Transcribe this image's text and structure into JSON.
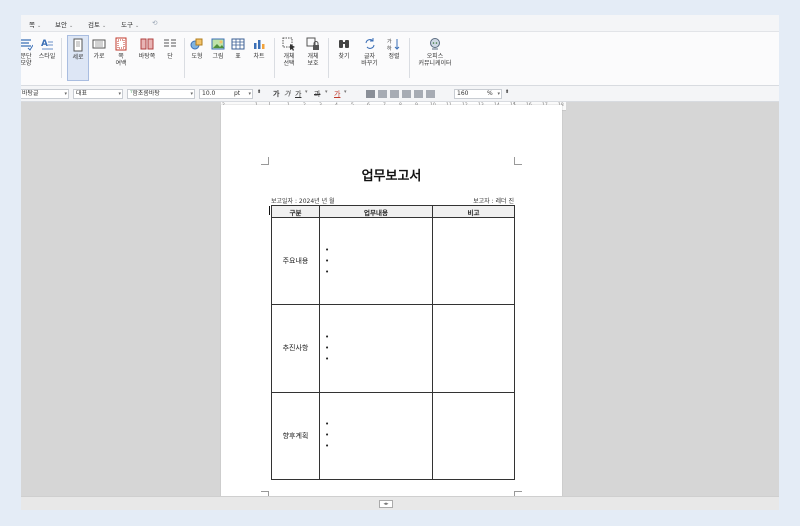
{
  "menubar": {
    "items": [
      {
        "label": "쪽"
      },
      {
        "label": "보안"
      },
      {
        "label": "검토"
      },
      {
        "label": "도구"
      }
    ],
    "chevron": "⌄"
  },
  "ribbon": {
    "buttons": [
      {
        "label": "문단\n모양",
        "icon": "paragraph-shape-icon"
      },
      {
        "label": "스타일",
        "icon": "style-icon"
      },
      {
        "label": "세로",
        "icon": "portrait-icon",
        "active": true
      },
      {
        "label": "가로",
        "icon": "landscape-icon"
      },
      {
        "label": "쪽\n여백",
        "icon": "page-margin-icon"
      },
      {
        "label": "바탕쪽",
        "icon": "master-page-icon"
      },
      {
        "label": "단",
        "icon": "columns-icon"
      },
      {
        "label": "도형",
        "icon": "shape-icon"
      },
      {
        "label": "그림",
        "icon": "picture-icon"
      },
      {
        "label": "표",
        "icon": "table-icon"
      },
      {
        "label": "차트",
        "icon": "chart-icon"
      },
      {
        "label": "개체\n선택",
        "icon": "select-object-icon"
      },
      {
        "label": "개체\n보호",
        "icon": "protect-object-icon"
      },
      {
        "label": "찾기",
        "icon": "find-icon"
      },
      {
        "label": "글자\n바꾸기",
        "icon": "replace-text-icon"
      },
      {
        "label": "정렬",
        "icon": "sort-icon"
      },
      {
        "label": "오피스\n커뮤니케이터",
        "icon": "office-communicator-icon"
      }
    ]
  },
  "format_bar": {
    "style": "바탕글",
    "language": "대표",
    "font": "함초롬바탕",
    "size": "10.0",
    "unit": "pt",
    "bold": "가",
    "italic": "가",
    "underline": "가",
    "strike": "과",
    "color": "가",
    "zoom": "160",
    "zoom_unit": "%"
  },
  "ruler": {
    "numbers": [
      "2",
      "1",
      "1",
      "2",
      "3",
      "4",
      "5",
      "6",
      "7",
      "8",
      "9",
      "10",
      "11",
      "12",
      "13",
      "14",
      "15",
      "16",
      "17",
      "18"
    ]
  },
  "document": {
    "title": "업무보고서",
    "report_date": "보고일자 : 2024년    년    월",
    "reporter": "보고자 : 레더 진",
    "headers": [
      "구분",
      "업무내용",
      "비고"
    ],
    "rows": [
      {
        "category": "주요내용",
        "bullets": [
          "•",
          "•",
          "•"
        ]
      },
      {
        "category": "추진사항",
        "bullets": [
          "•",
          "•",
          "•"
        ]
      },
      {
        "category": "향후계획",
        "bullets": [
          "•",
          "•",
          "•"
        ]
      }
    ]
  }
}
